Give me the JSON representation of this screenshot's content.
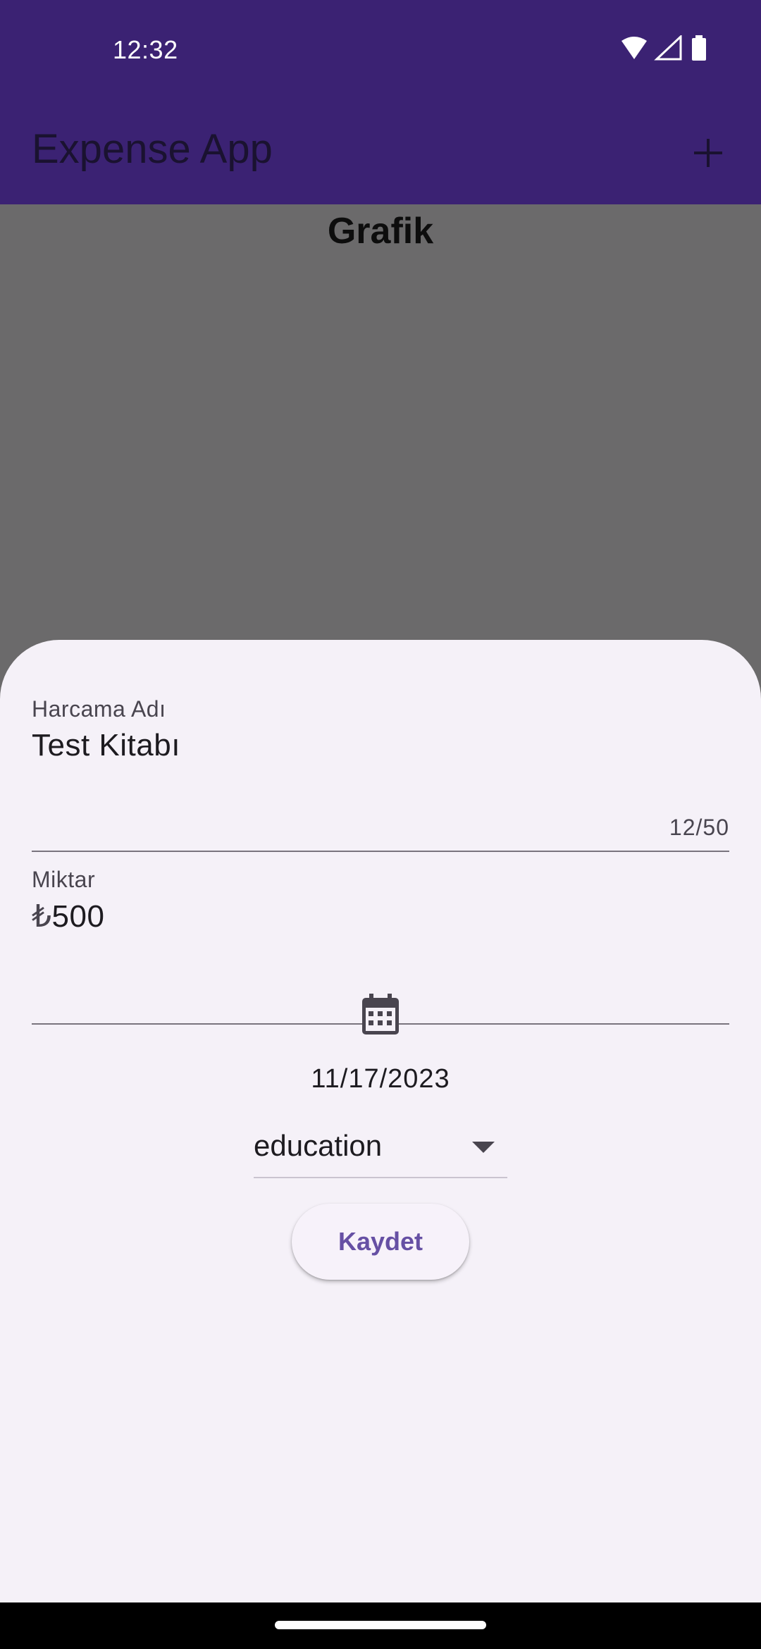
{
  "status_bar": {
    "time": "12:32",
    "icons": [
      "wifi-icon",
      "signal-icon",
      "battery-icon"
    ]
  },
  "app_bar": {
    "title": "Expense App",
    "action_icon": "plus-icon"
  },
  "background": {
    "chart_title": "Grafik"
  },
  "sheet": {
    "name_field": {
      "label": "Harcama Adı",
      "value": "Test Kitabı",
      "counter": "12/50"
    },
    "amount_field": {
      "label": "Miktar",
      "prefix": "₺",
      "value": "500"
    },
    "date": {
      "icon": "calendar-icon",
      "value": "11/17/2023"
    },
    "category": {
      "selected": "education"
    },
    "save_label": "Kaydet"
  },
  "colors": {
    "app_bar": "#3b2273",
    "scrim_background": "#6b6a6b",
    "sheet_background": "#f5f1f8",
    "accent": "#6650a4"
  }
}
